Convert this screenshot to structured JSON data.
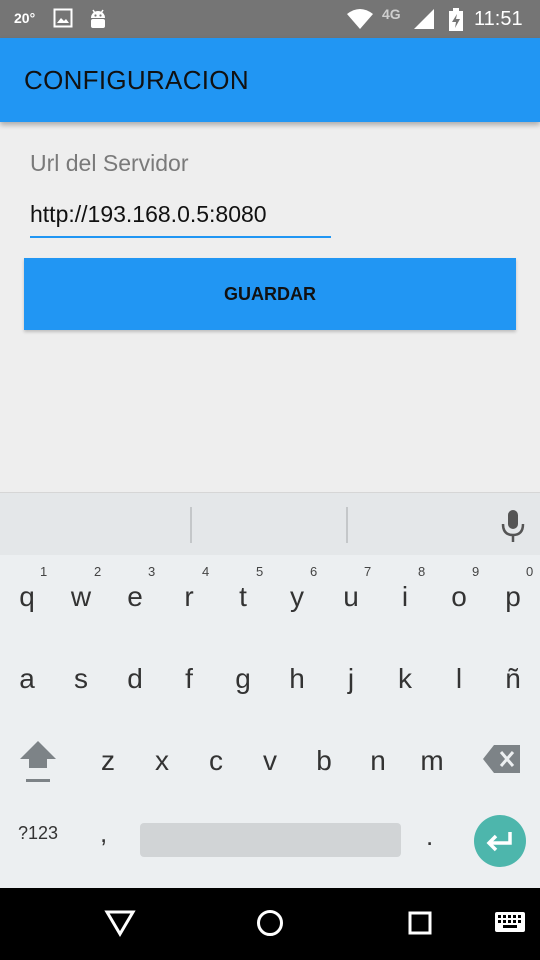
{
  "status_bar": {
    "temperature": "20°",
    "time": "11:51",
    "network": "4G",
    "icons": [
      "image-icon",
      "android-icon",
      "wifi-icon",
      "signal-icon",
      "battery-charging-icon"
    ]
  },
  "app_bar": {
    "title": "CONFIGURACION"
  },
  "form": {
    "label": "Url del Servidor",
    "value": "http://193.168.0.5:8080",
    "save_label": "GUARDAR"
  },
  "keyboard": {
    "row1": [
      {
        "key": "q",
        "hint": "1"
      },
      {
        "key": "w",
        "hint": "2"
      },
      {
        "key": "e",
        "hint": "3"
      },
      {
        "key": "r",
        "hint": "4"
      },
      {
        "key": "t",
        "hint": "5"
      },
      {
        "key": "y",
        "hint": "6"
      },
      {
        "key": "u",
        "hint": "7"
      },
      {
        "key": "i",
        "hint": "8"
      },
      {
        "key": "o",
        "hint": "9"
      },
      {
        "key": "p",
        "hint": "0"
      }
    ],
    "row2": [
      "a",
      "s",
      "d",
      "f",
      "g",
      "h",
      "j",
      "k",
      "l",
      "ñ"
    ],
    "row3": [
      "z",
      "x",
      "c",
      "v",
      "b",
      "n",
      "m"
    ],
    "symbols_label": "?123",
    "comma": ",",
    "period": ".",
    "icons": [
      "microphone-icon",
      "shift-icon",
      "backspace-icon",
      "enter-icon"
    ]
  },
  "nav_bar": {
    "icons": [
      "back-icon",
      "home-icon",
      "recents-icon",
      "keyboard-icon"
    ]
  },
  "colors": {
    "accent": "#2196f3",
    "status_bar": "#757575",
    "enter_key": "#4db6ac"
  }
}
